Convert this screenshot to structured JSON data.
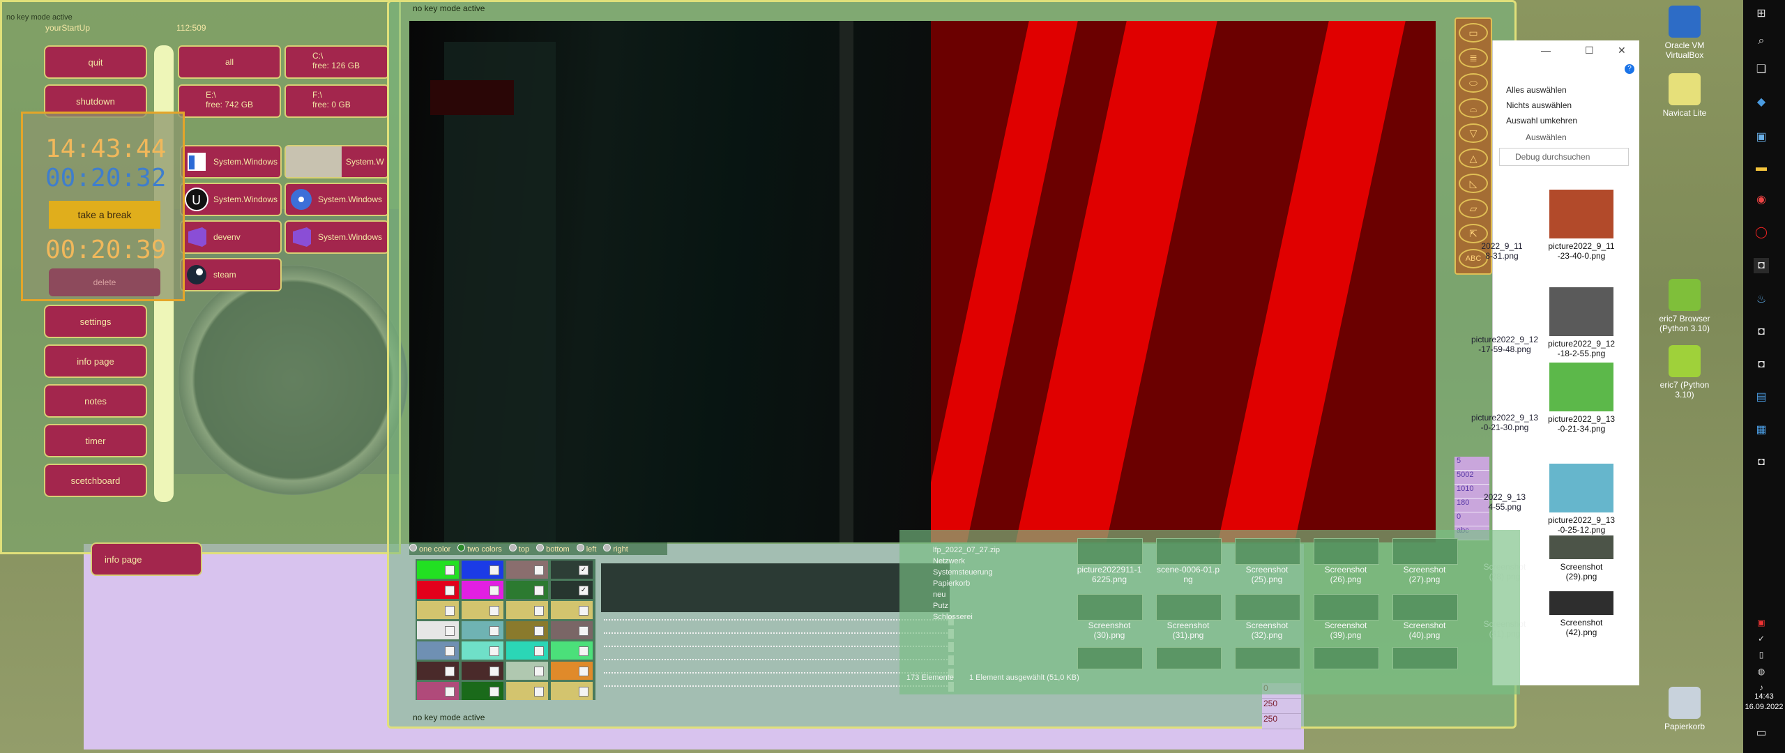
{
  "colors": {
    "accent_red": "#a3264d",
    "gold_border": "#d8cf75",
    "panel_green": "#78b982",
    "stripe_red": "#e00000"
  },
  "launcher": {
    "title": "yourStartUp",
    "coords": "112:509",
    "overlay_text": "no key mode active",
    "left_buttons": [
      "quit",
      "shutdown",
      "settings",
      "info page",
      "notes",
      "timer",
      "scetchboard"
    ],
    "info_page_lower": "info page",
    "drives": [
      {
        "label": "all",
        "free": ""
      },
      {
        "label": "C:\\",
        "free": "free: 126 GB"
      },
      {
        "label": "E:\\",
        "free": "free: 742 GB"
      },
      {
        "label": "F:\\",
        "free": "free: 0 GB"
      }
    ],
    "apps": [
      {
        "label": "System.Windows",
        "icon": "window-icon"
      },
      {
        "label": "System.W",
        "icon": "image-icon"
      },
      {
        "label": "System.Windows",
        "icon": "unreal-icon"
      },
      {
        "label": "System.Windows",
        "icon": "disc-icon"
      },
      {
        "label": "devenv",
        "icon": "visual-studio-icon"
      },
      {
        "label": "System.Windows",
        "icon": "visual-studio-icon"
      },
      {
        "label": "steam",
        "icon": "steam-icon"
      }
    ],
    "clock": {
      "current_time": "14:43:44",
      "timer_1": "00:20:32",
      "break_button": "take a break",
      "timer_2": "00:20:39",
      "delete_button": "delete"
    }
  },
  "main": {
    "status_top": "no key mode active",
    "status_bottom": "no key mode active",
    "options": [
      {
        "label": "one color",
        "selected": false
      },
      {
        "label": "two colors",
        "selected": true
      },
      {
        "label": "top",
        "selected": false
      },
      {
        "label": "bottom",
        "selected": false
      },
      {
        "label": "left",
        "selected": false
      },
      {
        "label": "right",
        "selected": false
      }
    ],
    "swatches": [
      {
        "color": "#22e022",
        "checked": false
      },
      {
        "color": "#1b3be6",
        "checked": false
      },
      {
        "color": "#8a6e6e",
        "checked": false
      },
      {
        "color": "#2d3e36",
        "checked": true
      },
      {
        "color": "#e3001b",
        "checked": false
      },
      {
        "color": "#e21fe2",
        "checked": false
      },
      {
        "color": "#2c7a30",
        "checked": false
      },
      {
        "color": "#27362f",
        "checked": true
      },
      {
        "color": "#d3c46e",
        "checked": false
      },
      {
        "color": "#d3c46e",
        "checked": false
      },
      {
        "color": "#d3c46e",
        "checked": false
      },
      {
        "color": "#d3c46e",
        "checked": false
      },
      {
        "color": "#e6e6e6",
        "checked": false
      },
      {
        "color": "#6fb3b3",
        "checked": false
      },
      {
        "color": "#8a7a2c",
        "checked": false
      },
      {
        "color": "#7a6666",
        "checked": false
      },
      {
        "color": "#6f90b3",
        "checked": false
      },
      {
        "color": "#6fe0c8",
        "checked": false
      },
      {
        "color": "#2bd6b6",
        "checked": false
      },
      {
        "color": "#4be07a",
        "checked": false
      },
      {
        "color": "#4a2a2a",
        "checked": false
      },
      {
        "color": "#4a2a2a",
        "checked": false
      },
      {
        "color": "#b0c8b0",
        "checked": false
      },
      {
        "color": "#e08a2a",
        "checked": false
      },
      {
        "color": "#b04a7a",
        "checked": false
      },
      {
        "color": "#1a6a1a",
        "checked": false
      },
      {
        "color": "#d3c46e",
        "checked": false
      },
      {
        "color": "#d3c46e",
        "checked": false
      }
    ],
    "palette_tools": [
      "rectangle-tool-icon",
      "stack-tool-icon",
      "ellipse-tool-icon",
      "cylinder-tool-icon",
      "triangle-down-tool-icon",
      "triangle-tool-icon",
      "right-triangle-tool-icon",
      "parallelogram-tool-icon",
      "arrow-tool-icon",
      "text-tool-icon"
    ],
    "palette_text_label": "ABC",
    "ruler_values": [
      "5",
      "5002",
      "1010",
      "180",
      "0",
      "abc"
    ],
    "bottom_values": [
      "0",
      "250",
      "250"
    ]
  },
  "explorer": {
    "ribbon": [
      "Alles auswählen",
      "Nichts auswählen",
      "Auswahl umkehren",
      "Auswählen"
    ],
    "search_placeholder": "Debug durchsuchen",
    "thumbnails": [
      {
        "label": "picture2022_9_11\n-23-40-0.png",
        "color": "#b24a2a"
      },
      {
        "label": "picture2022_9_12\n-18-2-55.png",
        "color": "#5a5a5a"
      },
      {
        "label": "picture2022_9_13\n-0-21-34.png",
        "color": "#5cb84a"
      },
      {
        "label": "picture2022_9_13\n-0-25-12.png",
        "color": "#66b6cc"
      },
      {
        "label": "Screenshot\n(29).png",
        "color": "#4c5448"
      },
      {
        "label": "Screenshot\n(42).png",
        "color": "#2e2e2e"
      }
    ],
    "partial_labels": [
      "2022_9_11\n8-31.png",
      "picture2022_9_12\n-17-59-48.png",
      "picture2022_9_13\n-0-21-30.png",
      "2022_9_13\n4-55.png",
      "Screenshot\n(28).png",
      "Screenshot\n(41).png"
    ],
    "nav_items": [
      "lfp_2022_07_27.zip",
      "Netzwerk",
      "Systemsteuerung",
      "Papierkorb",
      "neu",
      "Putz",
      "Schlosserei"
    ],
    "status": "1 Element ausgewählt (51,0 KB)",
    "count": "173 Elemente",
    "bottom_files": [
      "picture2022911-1\n6225.png",
      "scene-0006-01.p\nng",
      "Screenshot\n(25).png",
      "Screenshot\n(26).png",
      "Screenshot\n(27).png",
      "Screenshot\n(30).png",
      "Screenshot\n(31).png",
      "Screenshot\n(32).png",
      "Screenshot\n(39).png",
      "Screenshot\n(40).png"
    ]
  },
  "desktop": {
    "icons": [
      {
        "label": "Oracle VM VirtualBox",
        "icon": "virtualbox-icon",
        "color": "#2d6cc6"
      },
      {
        "label": "Navicat Lite",
        "icon": "navicat-icon",
        "color": "#e6e07a"
      },
      {
        "label": "eric7 Browser\n(Python 3.10)",
        "icon": "eric-browser-icon",
        "color": "#7fbf3a"
      },
      {
        "label": "eric7 (Python 3.10)",
        "icon": "eric-icon",
        "color": "#9fd13a"
      },
      {
        "label": "Papierkorb",
        "icon": "recycle-bin-icon",
        "color": "#c8d2dc"
      }
    ],
    "clock_time": "14:43",
    "clock_date": "16.09.2022"
  }
}
